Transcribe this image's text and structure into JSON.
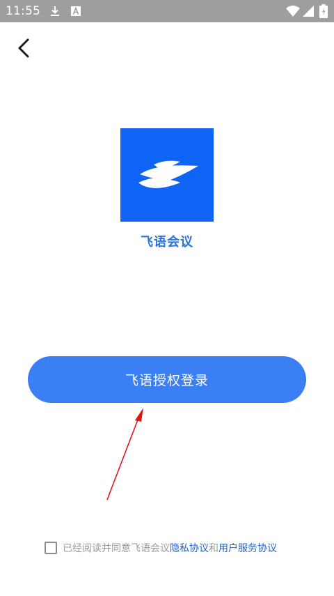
{
  "status_bar": {
    "time": "11:55",
    "icons": [
      "download-icon",
      "a-notification-icon",
      "wifi-icon",
      "signal-icon",
      "battery-icon"
    ]
  },
  "header": {
    "back_icon": "back-arrow-icon"
  },
  "app": {
    "name": "飞语会议",
    "logo_icon": "feiyu-logo-icon",
    "brand_color": "#0f63f5"
  },
  "login": {
    "button_label": "飞语授权登录",
    "button_color": "#3b7ff5"
  },
  "agreement": {
    "prefix": "已经阅读并同意飞语会议",
    "privacy_link": "隐私协议",
    "conjunction": "和",
    "service_link": "用户服务协议",
    "checked": false,
    "link_color": "#1e63c8"
  },
  "annotation": {
    "arrow_color": "#e01616"
  }
}
